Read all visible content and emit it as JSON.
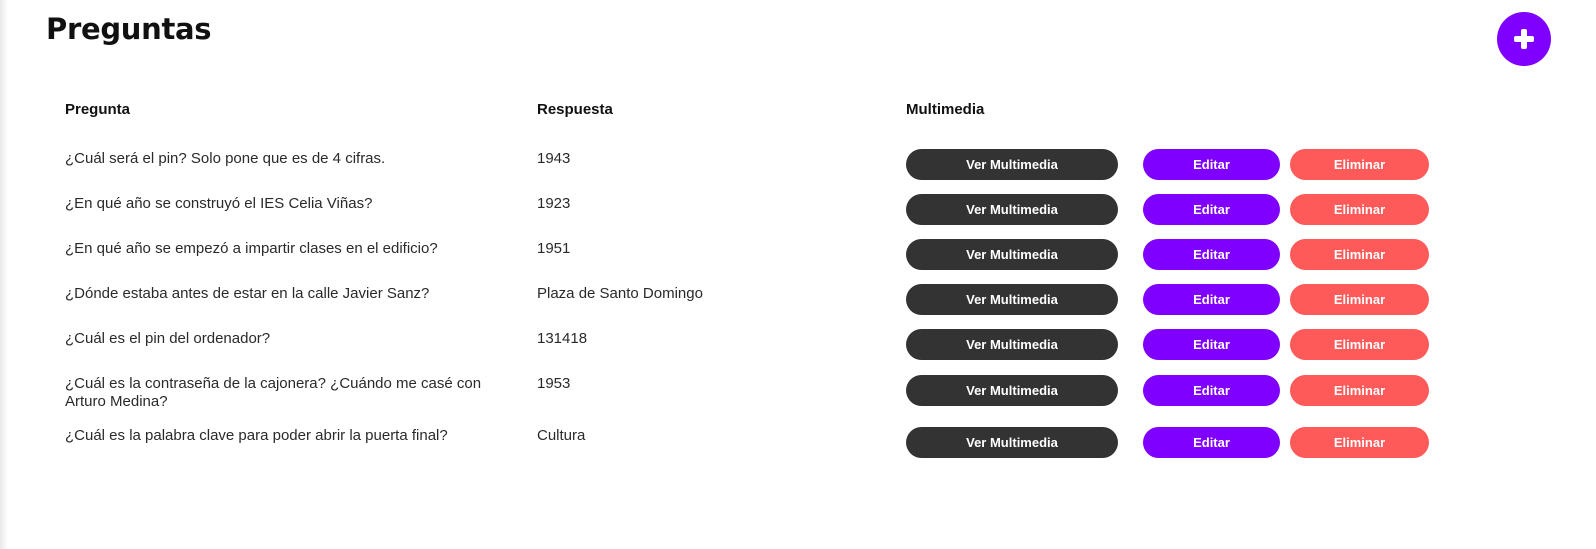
{
  "page": {
    "title": "Preguntas"
  },
  "add_button": {
    "icon": "plus-icon",
    "color": "#8000ff"
  },
  "table": {
    "headers": {
      "question": "Pregunta",
      "answer": "Respuesta",
      "media": "Multimedia"
    },
    "rows": [
      {
        "question": "¿Cuál será el pin? Solo pone que es de 4 cifras.",
        "answer": "1943"
      },
      {
        "question": "¿En qué año se construyó el IES Celia Viñas?",
        "answer": "1923"
      },
      {
        "question": "¿En qué año se empezó a impartir clases en el edificio?",
        "answer": "1951"
      },
      {
        "question": "¿Dónde estaba antes de estar en la calle Javier Sanz?",
        "answer": "Plaza de Santo Domingo"
      },
      {
        "question": "¿Cuál es el pin del ordenador?",
        "answer": "131418"
      },
      {
        "question": "¿Cuál es la contraseña de la cajonera? ¿Cuándo me casé con Arturo Medina?",
        "answer": "1953"
      },
      {
        "question": "¿Cuál es la palabra clave para poder abrir la puerta final?",
        "answer": "Cultura"
      }
    ]
  },
  "buttons": {
    "media_label": "Ver Multimedia",
    "edit_label": "Editar",
    "delete_label": "Eliminar",
    "media_color": "#333333",
    "edit_color": "#8000ff",
    "delete_color": "#ff5a5a"
  }
}
